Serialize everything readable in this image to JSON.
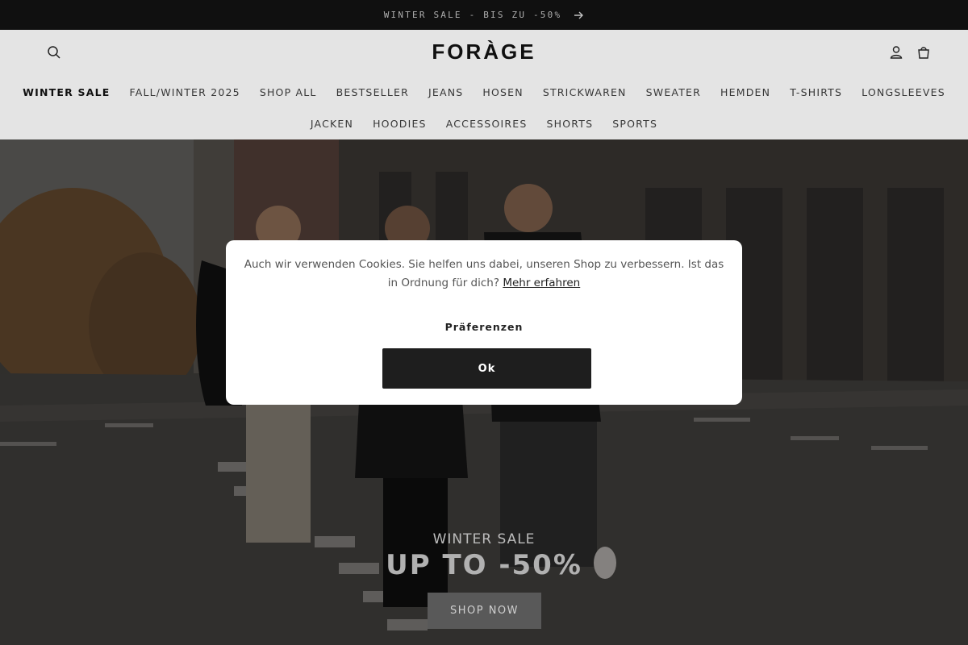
{
  "announcement": {
    "text": "WINTER SALE - BIS ZU -50%",
    "arrow_icon": "arrow-right-icon"
  },
  "header": {
    "logo": "FORÀGE",
    "icons": {
      "search": "search-icon",
      "account": "user-icon",
      "cart": "cart-icon"
    },
    "nav_row1": [
      "WINTER SALE",
      "FALL/WINTER 2025",
      "SHOP ALL",
      "BESTSELLER",
      "JEANS",
      "HOSEN",
      "STRICKWAREN",
      "SWEATER",
      "HEMDEN",
      "T-SHIRTS",
      "LONGSLEEVES"
    ],
    "nav_row2": [
      "JACKEN",
      "HOODIES",
      "ACCESSOIRES",
      "SHORTS",
      "SPORTS"
    ]
  },
  "hero": {
    "kicker": "WINTER SALE",
    "heading": "UP TO -50%",
    "cta": "SHOP NOW"
  },
  "cookie_banner": {
    "text": "Auch wir verwenden Cookies. Sie helfen uns dabei, unseren Shop zu verbessern. Ist das in Ordnung für dich?",
    "link": "Mehr erfahren",
    "preferences": "Präferenzen",
    "ok": "Ok"
  },
  "colors": {
    "header_bg": "#f3f3f3",
    "announce_bg": "#121212",
    "button_dark": "#1e1e1e"
  }
}
